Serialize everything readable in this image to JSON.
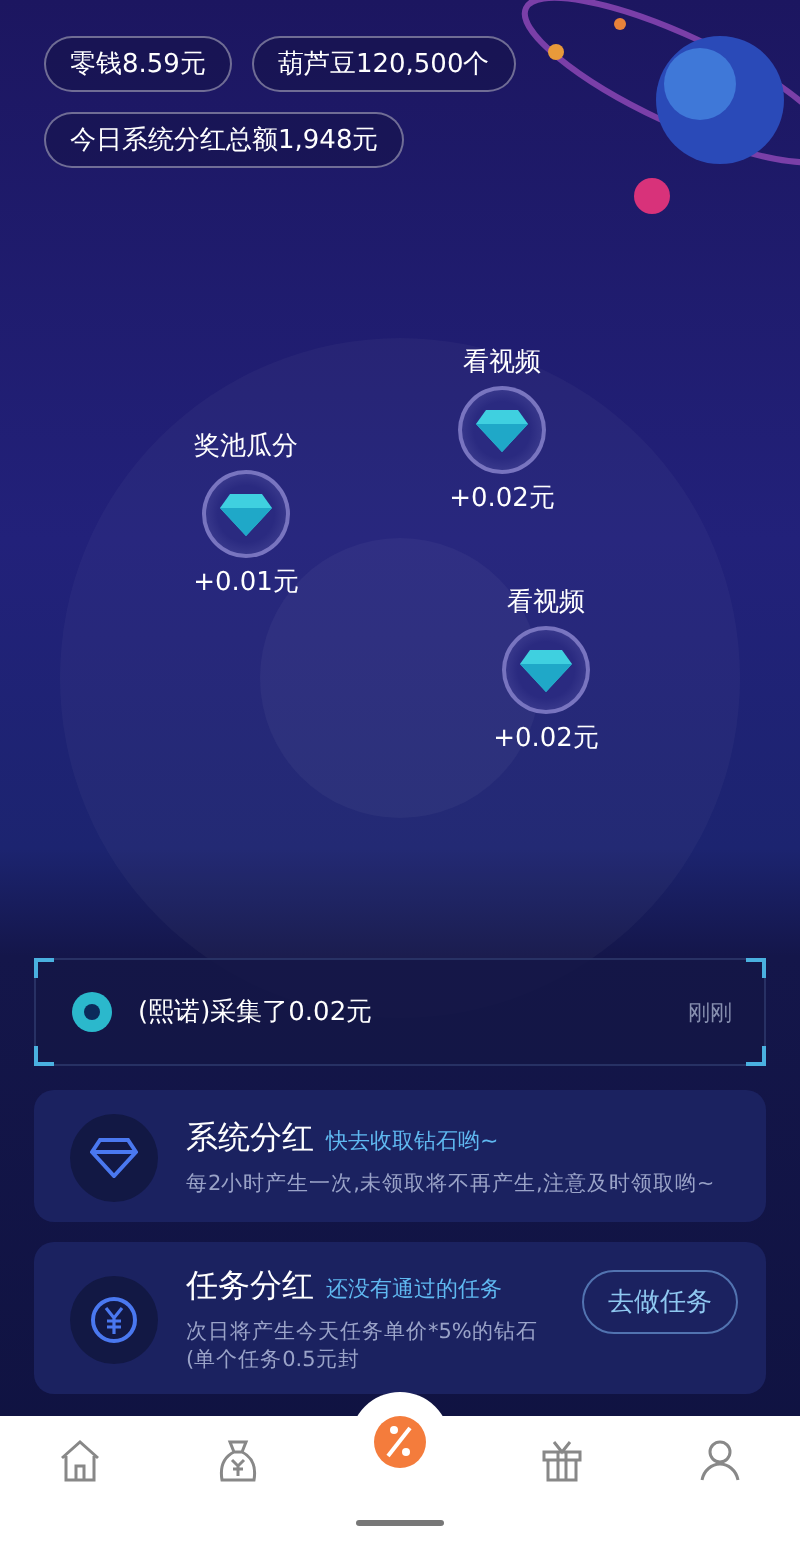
{
  "balances": [
    {
      "text": "零钱8.59元"
    },
    {
      "text": "葫芦豆120,500个"
    },
    {
      "text": "今日系统分红总额1,948元"
    }
  ],
  "rewards": [
    {
      "label": "奖池瓜分",
      "amount": "+0.01元"
    },
    {
      "label": "看视频",
      "amount": "+0.02元"
    },
    {
      "label": "看视频",
      "amount": "+0.02元"
    }
  ],
  "feed": {
    "message": "(熙诺)采集了0.02元",
    "time": "刚刚"
  },
  "cards": [
    {
      "kind": "diamond",
      "title": "系统分红",
      "subtitle": "快去收取钻石哟~",
      "description": "每2小时产生一次,未领取将不再产生,注意及时领取哟~"
    },
    {
      "kind": "yuan",
      "title": "任务分红",
      "subtitle": "还没有通过的任务",
      "description": "次日将产生今天任务单价*5%的钻石(单个任务0.5元封",
      "button": "去做任务"
    }
  ],
  "tabs": [
    {
      "kind": "home",
      "selected": false
    },
    {
      "kind": "bag",
      "selected": false
    },
    {
      "kind": "center",
      "selected": true
    },
    {
      "kind": "gift",
      "selected": false
    },
    {
      "kind": "user",
      "selected": false
    }
  ]
}
